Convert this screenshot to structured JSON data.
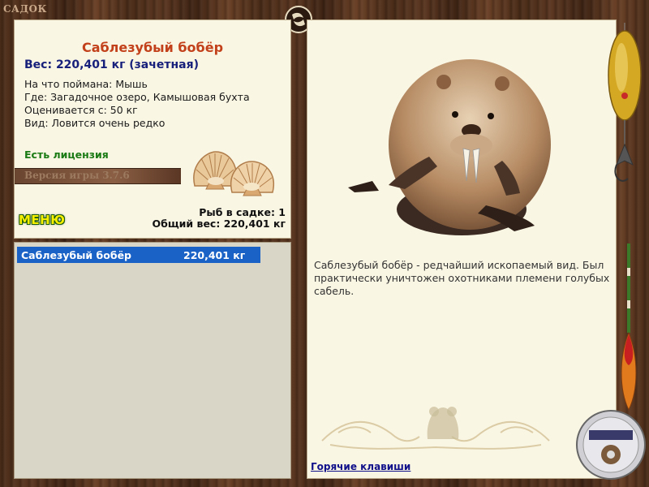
{
  "window": {
    "title": "САДОК"
  },
  "fish": {
    "name": "Саблезубый бобёр",
    "weight_line": "Вес: 220,401 кг (зачетная)",
    "details": [
      "На что поймана: Мышь",
      "Где: Загадочное озеро, Камышовая бухта",
      "Оценивается с: 50 кг",
      "Вид: Ловится очень редко"
    ],
    "license": "Есть лицензия",
    "description": "Саблезубый бобёр - редчайший ископаемый вид. Был практически уничтожен охотниками племени голубых сабель."
  },
  "game": {
    "version": "Версия игры 3.7.6"
  },
  "menu": {
    "label": "МЕНЮ"
  },
  "stats": {
    "fish_count": "Рыб в садке: 1",
    "total_weight": "Общий вес: 220,401 кг"
  },
  "list": {
    "items": [
      {
        "name": "Саблезубый бобёр",
        "weight": "220,401 кг"
      }
    ]
  },
  "footer": {
    "hotkeys_label": "Горячие клавиши"
  },
  "colors": {
    "fish_name": "#c2401a",
    "weight": "#17207a",
    "license": "#1a7a14",
    "selection": "#1a62c6",
    "link": "#10108a"
  }
}
